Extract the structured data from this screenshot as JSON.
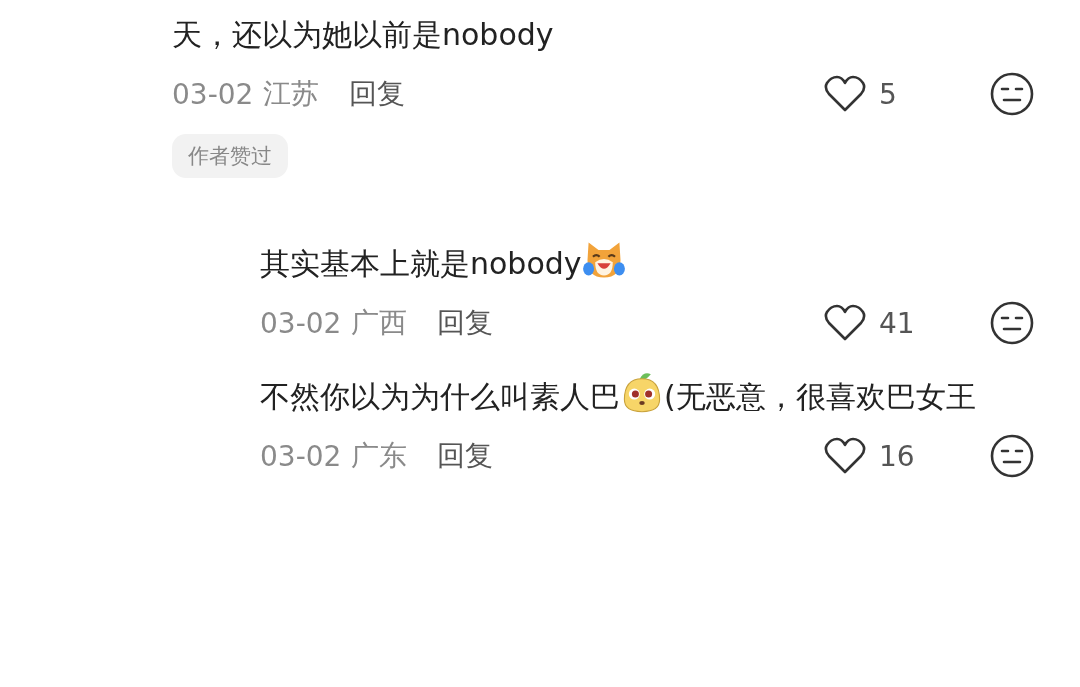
{
  "comments": [
    {
      "parts": [
        {
          "kind": "text",
          "text": "天，还以为她以前是nobody"
        }
      ],
      "date": "03-02",
      "region": "江苏",
      "reply": "回复",
      "likes": "5",
      "badge": "作者赞过",
      "children": [
        {
          "parts": [
            {
              "kind": "text",
              "text": "其实基本上就是nobody"
            },
            {
              "kind": "cat"
            }
          ],
          "date": "03-02",
          "region": "广西",
          "reply": "回复",
          "likes": "41"
        },
        {
          "parts": [
            {
              "kind": "text",
              "text": "不然你以为为什么叫素人巴"
            },
            {
              "kind": "mascot"
            },
            {
              "kind": "text",
              "text": "(无恶意，很喜欢巴女王"
            }
          ],
          "date": "03-02",
          "region": "广东",
          "reply": "回复",
          "likes": "16"
        }
      ]
    }
  ]
}
